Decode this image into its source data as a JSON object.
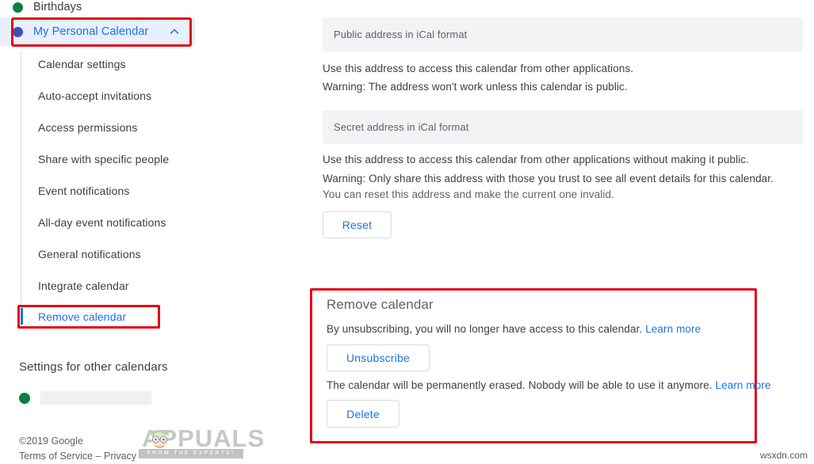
{
  "sidebar": {
    "calendars": [
      {
        "label": "Birthdays",
        "color": "#0b8043"
      },
      {
        "label": "My Personal Calendar",
        "color": "#3f51b5",
        "expanded": true,
        "chevron": "chevron-up-icon"
      }
    ],
    "sub_items": [
      "Calendar settings",
      "Auto-accept invitations",
      "Access permissions",
      "Share with specific people",
      "Event notifications",
      "All-day event notifications",
      "General notifications",
      "Integrate calendar"
    ],
    "active_sub_item": "Remove calendar",
    "other_section_title": "Settings for other calendars",
    "other_calendar_color": "#0b8043",
    "footer": {
      "copyright": "©2019 Google",
      "terms": "Terms of Service",
      "separator": "–",
      "privacy": "Privacy"
    }
  },
  "main": {
    "public_address": {
      "field_value": "Public address in iCal format",
      "help": "Use this address to access this calendar from other applications.",
      "warning": "Warning: The address won't work unless this calendar is public."
    },
    "secret_address": {
      "field_value": "Secret address in iCal format",
      "help": "Use this address to access this calendar from other applications without making it public.",
      "warning": "Warning: Only share this address with those you trust to see all event details for this calendar.",
      "note": "You can reset this address and make the current one invalid.",
      "reset_label": "Reset"
    },
    "remove_calendar": {
      "title": "Remove calendar",
      "unsubscribe_text": "By unsubscribing, you will no longer have access to this calendar.",
      "unsubscribe_link": "Learn more",
      "unsubscribe_label": "Unsubscribe",
      "delete_text": "The calendar will be permanently erased. Nobody will be able to use it anymore.",
      "delete_link": "Learn more",
      "delete_label": "Delete"
    }
  },
  "watermark": {
    "brand": "APPUALS",
    "tagline": "FROM THE EXPERTS!",
    "corner": "wsxdn.com"
  },
  "colors": {
    "accent_blue": "#1a73e8",
    "annotation_red": "#e30613",
    "highlight_bg": "#e8f0fe",
    "field_bg": "#f1f3f4"
  }
}
